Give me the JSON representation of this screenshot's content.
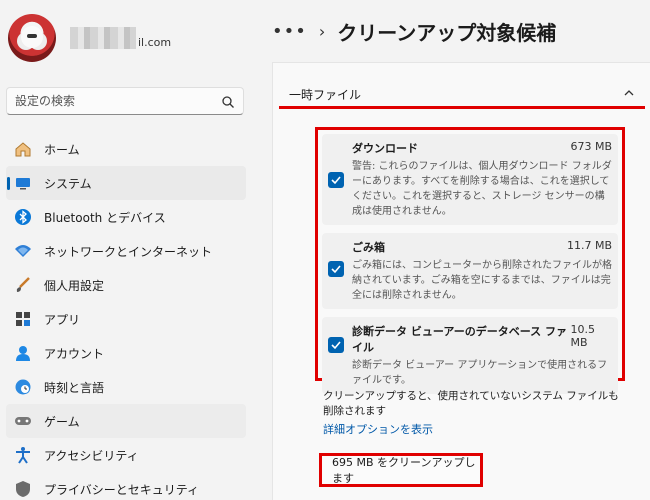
{
  "profile": {
    "email_visible": "il.com"
  },
  "search": {
    "placeholder": "設定の検索"
  },
  "nav": {
    "items": [
      {
        "label": "ホーム",
        "icon": "home-icon"
      },
      {
        "label": "システム",
        "icon": "system-icon",
        "active": true
      },
      {
        "label": "Bluetooth とデバイス",
        "icon": "bluetooth-icon"
      },
      {
        "label": "ネットワークとインターネット",
        "icon": "wifi-icon"
      },
      {
        "label": "個人用設定",
        "icon": "brush-icon"
      },
      {
        "label": "アプリ",
        "icon": "apps-icon"
      },
      {
        "label": "アカウント",
        "icon": "person-icon"
      },
      {
        "label": "時刻と言語",
        "icon": "clock-globe-icon"
      },
      {
        "label": "ゲーム",
        "icon": "gamepad-icon"
      },
      {
        "label": "アクセシビリティ",
        "icon": "accessibility-icon"
      },
      {
        "label": "プライバシーとセキュリティ",
        "icon": "shield-icon"
      }
    ]
  },
  "header": {
    "breadcrumb_more": "•••",
    "title": "クリーンアップ対象候補"
  },
  "section": {
    "title": "一時ファイル"
  },
  "files": [
    {
      "name": "ダウンロード",
      "size": "673 MB",
      "checked": true,
      "desc": "警告: これらのファイルは、個人用ダウンロード フォルダーにあります。すべてを削除する場合は、これを選択してください。これを選択すると、ストレージ センサーの構成は使用されません。"
    },
    {
      "name": "ごみ箱",
      "size": "11.7 MB",
      "checked": true,
      "desc": "ごみ箱には、コンピューターから削除されたファイルが格納されています。ごみ箱を空にするまでは、ファイルは完全には削除されません。"
    },
    {
      "name": "診断データ ビューアーのデータベース ファイル",
      "size": "10.5 MB",
      "checked": true,
      "desc": "診断データ ビューアー アプリケーションで使用されるファイルです。"
    }
  ],
  "note": "クリーンアップすると、使用されていないシステム ファイルも削除されます",
  "advanced_link": "詳細オプションを表示",
  "cleanup_button": "695 MB をクリーンアップします",
  "colors": {
    "accent": "#0063b1",
    "highlight": "#e00000",
    "link": "#0058a8"
  }
}
